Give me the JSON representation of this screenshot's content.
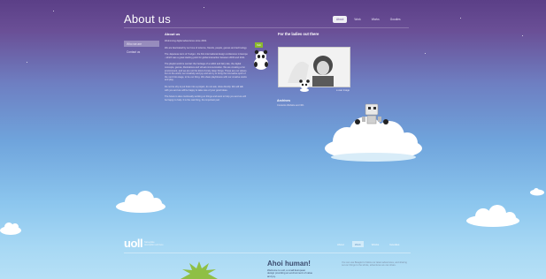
{
  "header": {
    "title": "About us",
    "nav": [
      {
        "label": "About",
        "active": true
      },
      {
        "label": "Work",
        "active": false
      },
      {
        "label": "Works",
        "active": false
      },
      {
        "label": "Goodies",
        "active": false
      }
    ]
  },
  "sidebar": {
    "items": [
      {
        "label": "Who we are",
        "active": true
      },
      {
        "label": "Contact us",
        "active": false
      }
    ]
  },
  "main": {
    "heading": "About us",
    "paragraphs": [
      "Welcoming digital adventures since 2002.",
      "We are fascinated by our love of science, friends, people, games and technology.",
      "The Japanese term of Yuulgui - the first international design conference in Europe - which was a great starting point for global interaction between 2003 and 2011.",
      "The playful world is central: the heritage of a rabbit and fairy tale, the digital concepts, games, illustrations and virtual communication. We are creating a fun environment, and we are not the kind of crazy deep things. These are our values. Fun in the world, our creativity and joy and we try to bring the innovative spirit of the nerd into stage, to be our thing. We share playfulness with our creative works and play.",
      "Do not be shy to put brain into a project, do not ask, draw directly. We will talk with you and we will be happy to take care of your good ideas.",
      "The future is also continually working on things and want to help you and we will be happy to help. It is the real thing, the important part."
    ]
  },
  "tag": "Vuh",
  "right": {
    "title": "For the ladies out there",
    "caption": "a user image",
    "section_heading": "Archives",
    "section_text": "Contents Website and 301"
  },
  "footer": {
    "logo": "uoll",
    "logo_sub": [
      "Nameplate",
      "description unit here"
    ],
    "nav": [
      {
        "label": "About",
        "active": false
      },
      {
        "label": "Work",
        "active": true
      },
      {
        "label": "Works",
        "active": false
      },
      {
        "label": "Goodies",
        "active": false
      }
    ],
    "ahoi_title": "Ahoi human!",
    "ahoi_text": "Welcome to uoll, a small European design providing an environment of value and joy.",
    "footer_text": "You can use Beaglet to follow our latest adventures, and sharing out our things to the whole, adventures we can share."
  },
  "colors": {
    "sky_top": "#5b3f87",
    "sky_mid": "#6fa4dc",
    "sky_bottom": "#b6e0f6",
    "accent_green": "#8bb92e",
    "footer_text": "#3b4b6e"
  }
}
